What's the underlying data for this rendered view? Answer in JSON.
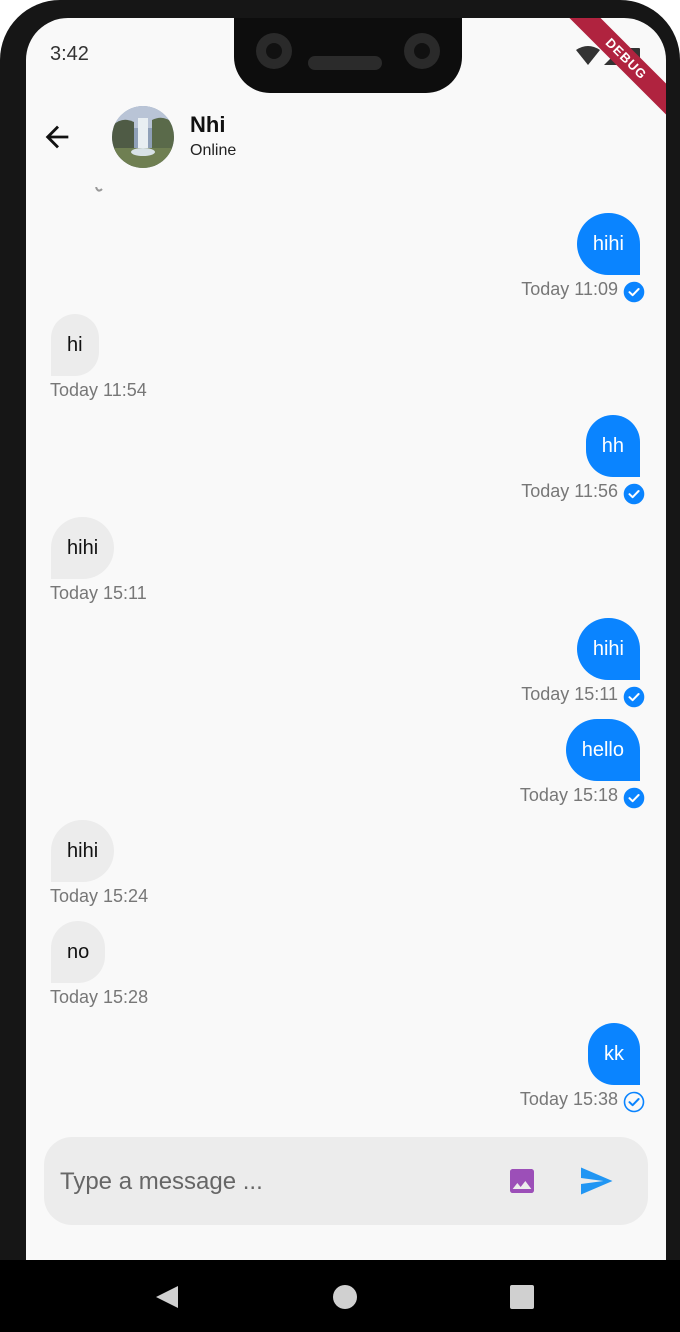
{
  "status_bar": {
    "time": "3:42",
    "debug_banner": "DEBUG"
  },
  "header": {
    "contact_name": "Nhi",
    "status": "Online"
  },
  "messages": [
    {
      "direction": "out",
      "text": "hihi",
      "time": "Today 11:09",
      "read": true
    },
    {
      "direction": "in",
      "text": "hi",
      "time": "Today 11:54"
    },
    {
      "direction": "out",
      "text": "hh",
      "time": "Today 11:56",
      "read": true
    },
    {
      "direction": "in",
      "text": "hihi",
      "time": "Today 15:11"
    },
    {
      "direction": "out",
      "text": "hihi",
      "time": "Today 15:11",
      "read": true
    },
    {
      "direction": "out",
      "text": "hello",
      "time": "Today 15:18",
      "read": true
    },
    {
      "direction": "in",
      "text": "hihi",
      "time": "Today 15:24"
    },
    {
      "direction": "in",
      "text": "no",
      "time": "Today 15:28"
    },
    {
      "direction": "out",
      "text": "kk",
      "time": "Today 15:38",
      "read": false
    }
  ],
  "composer": {
    "placeholder": "Type a message ..."
  },
  "icons": {
    "back": "arrow-back-icon",
    "image": "image-icon",
    "send": "send-icon",
    "read_receipt": "check-circle-icon"
  },
  "colors": {
    "outgoing_bubble": "#0a84ff",
    "incoming_bubble": "#ececec",
    "image_icon": "#9c4fb8",
    "send_icon": "#2196f3"
  }
}
